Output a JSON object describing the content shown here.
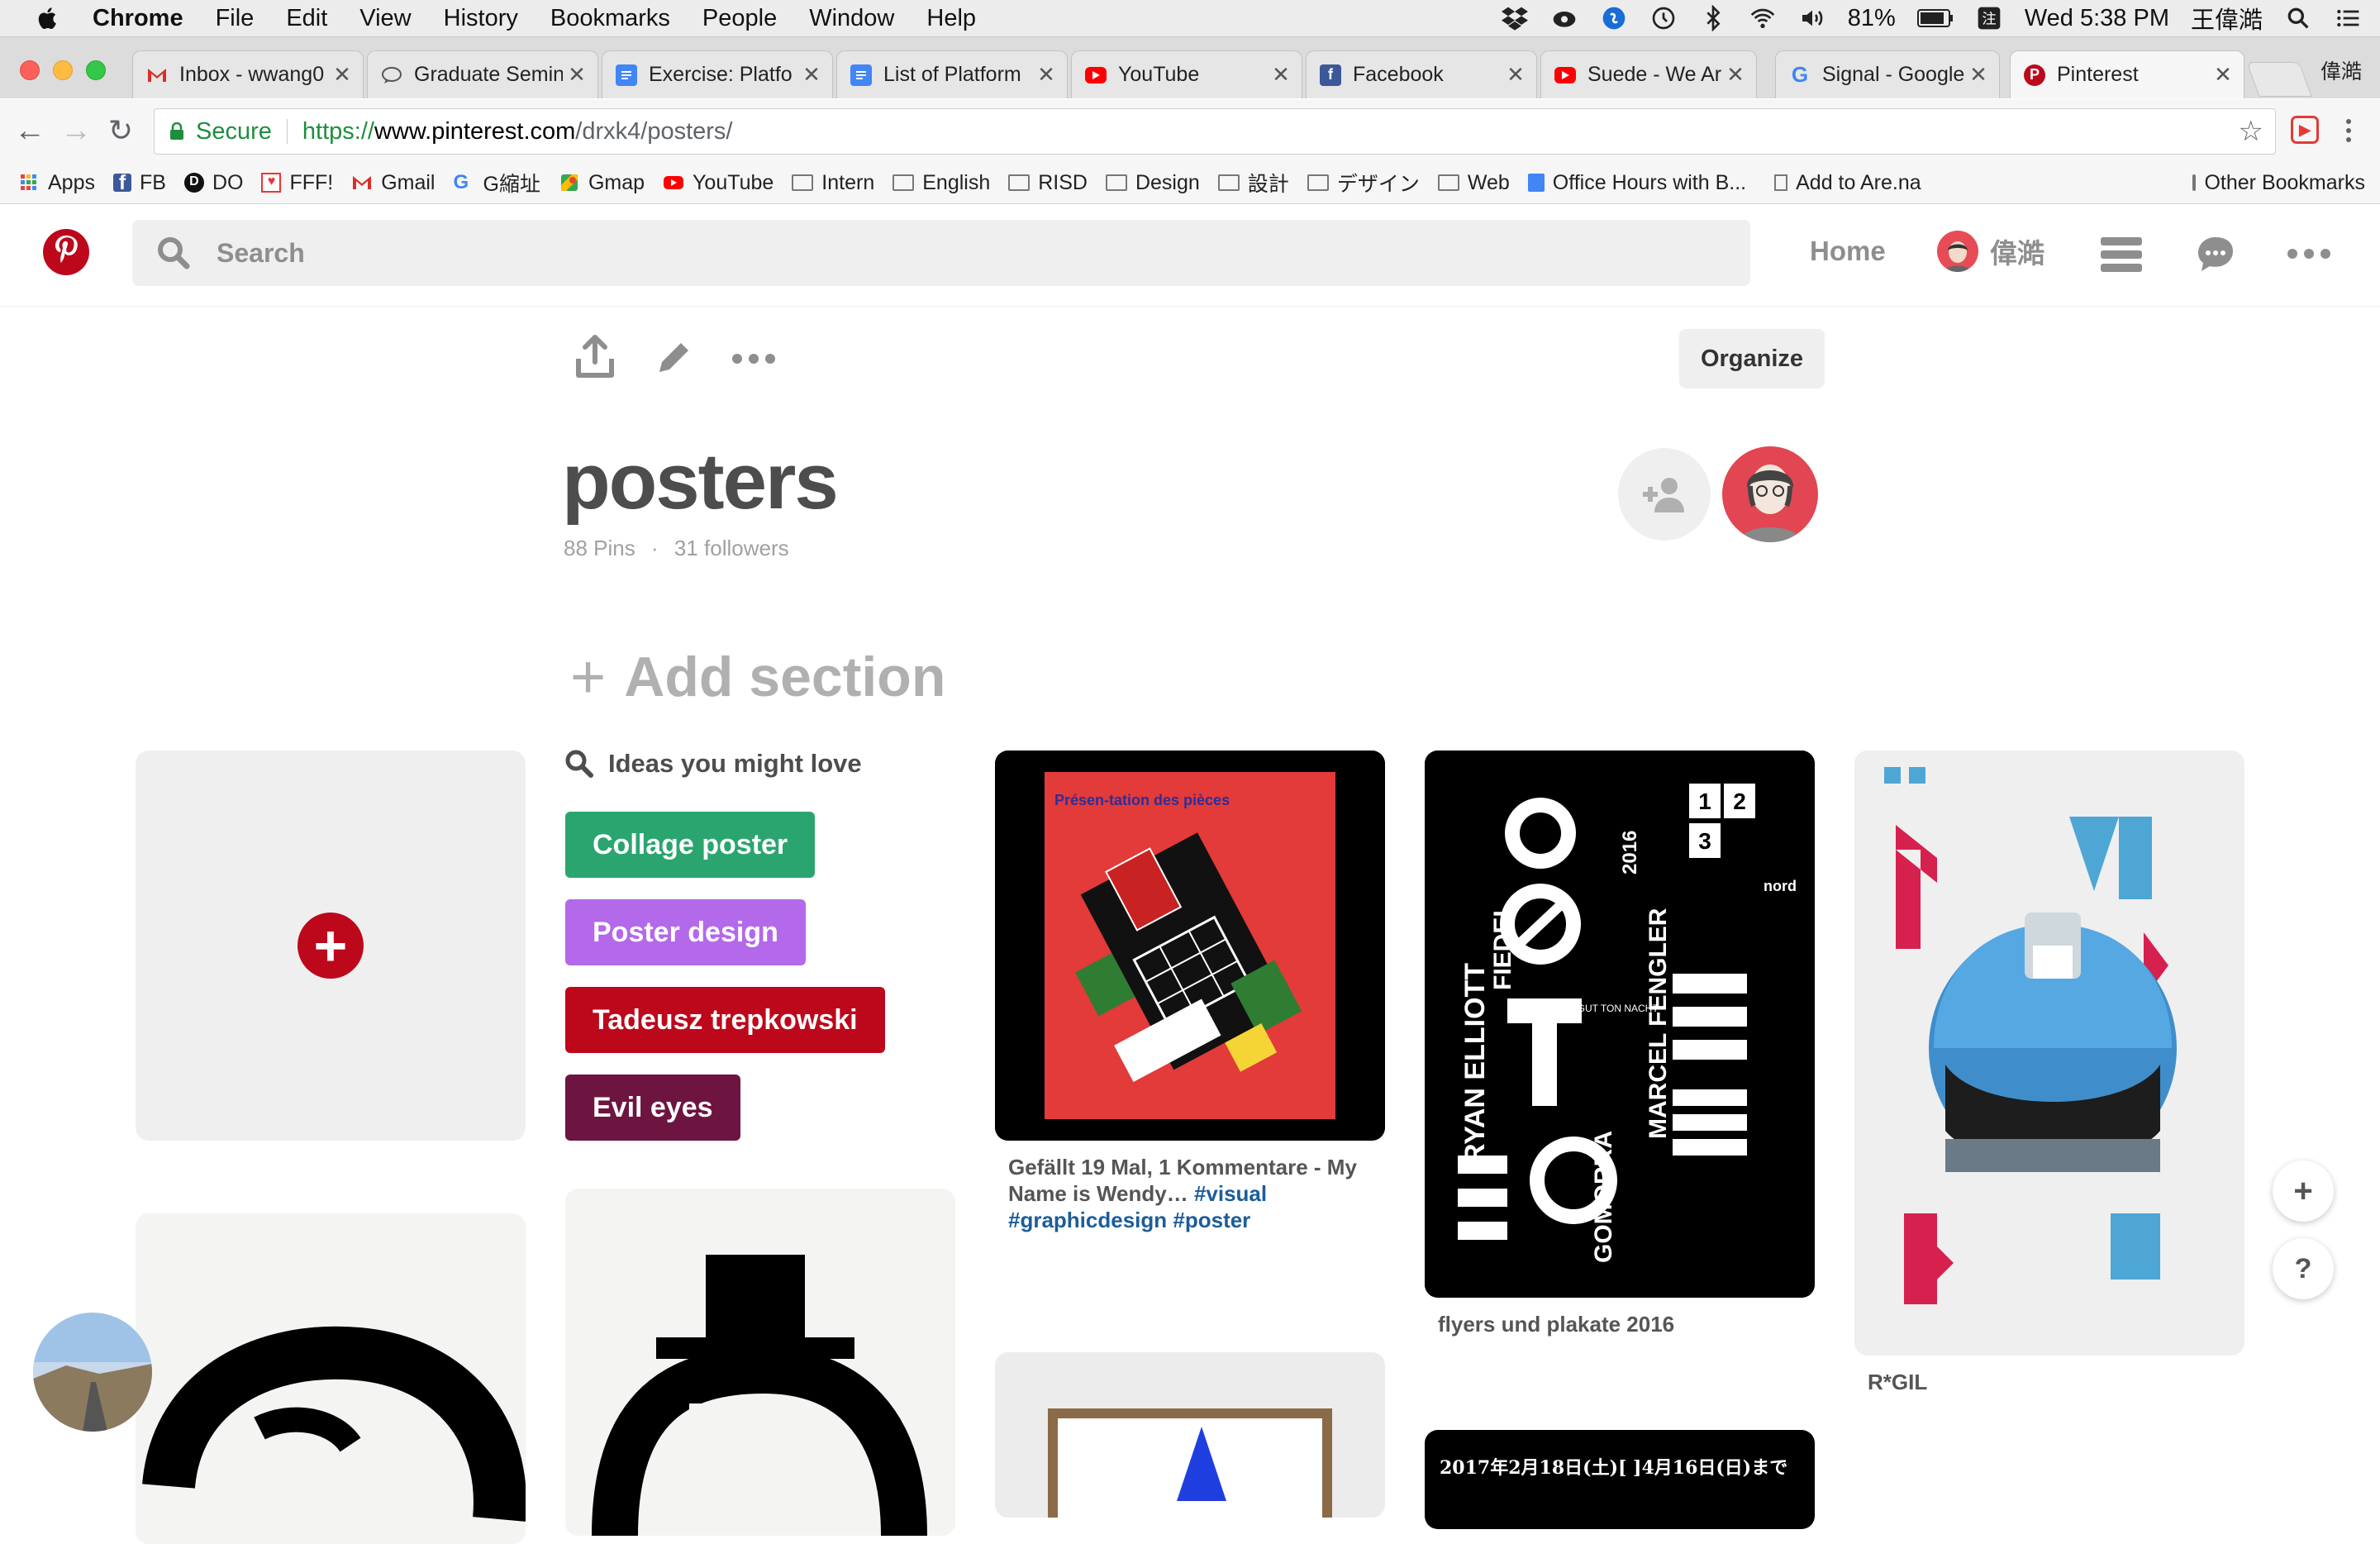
{
  "menubar": {
    "app": "Chrome",
    "items": [
      "File",
      "Edit",
      "View",
      "History",
      "Bookmarks",
      "People",
      "Window",
      "Help"
    ],
    "battery": "81%",
    "clock": "Wed 5:38 PM",
    "user": "王偉澔"
  },
  "tabs": [
    {
      "title": "Inbox - wwang0",
      "icon": "gmail-icon"
    },
    {
      "title": "Graduate Semin",
      "icon": "chat-bubble-icon"
    },
    {
      "title": "Exercise: Platfo",
      "icon": "google-docs-icon"
    },
    {
      "title": "List of Platform",
      "icon": "google-docs-icon"
    },
    {
      "title": "YouTube",
      "icon": "youtube-icon"
    },
    {
      "title": "Facebook",
      "icon": "facebook-icon"
    },
    {
      "title": "Suede - We Are",
      "icon": "youtube-icon"
    },
    {
      "title": "Signal - Google",
      "icon": "google-icon"
    },
    {
      "title": "Pinterest",
      "icon": "pinterest-icon"
    }
  ],
  "profile_name": "偉澔",
  "address": {
    "secure": "Secure",
    "scheme": "https://",
    "host": "www.pinterest.com",
    "path": "/drxk4/posters/"
  },
  "bookmarks": [
    {
      "label": "Apps",
      "icon": "apps-grid-icon"
    },
    {
      "label": "FB",
      "icon": "facebook-icon"
    },
    {
      "label": "DO",
      "icon": "digitalocean-icon"
    },
    {
      "label": "FFF!",
      "icon": "heart-icon"
    },
    {
      "label": "Gmail",
      "icon": "gmail-icon"
    },
    {
      "label": "G縮址",
      "icon": "google-icon"
    },
    {
      "label": "Gmap",
      "icon": "maps-icon"
    },
    {
      "label": "YouTube",
      "icon": "youtube-icon"
    },
    {
      "label": "Intern",
      "icon": "folder-icon"
    },
    {
      "label": "English",
      "icon": "folder-icon"
    },
    {
      "label": "RISD",
      "icon": "folder-icon"
    },
    {
      "label": "Design",
      "icon": "folder-icon"
    },
    {
      "label": "設計",
      "icon": "folder-icon"
    },
    {
      "label": "デザイン",
      "icon": "folder-icon"
    },
    {
      "label": "Web",
      "icon": "folder-icon"
    },
    {
      "label": "Office Hours with B...",
      "icon": "google-docs-icon"
    },
    {
      "label": "Add to Are.na",
      "icon": "page-icon"
    }
  ],
  "bookmarks_other": "Other Bookmarks",
  "pinterest": {
    "search_placeholder": "Search",
    "home": "Home",
    "username": "偉澔"
  },
  "board": {
    "organize": "Organize",
    "title": "posters",
    "pins": "88 Pins",
    "dot": "·",
    "followers": "31 followers",
    "add_section": "Add section"
  },
  "ideas": {
    "heading": "Ideas you might love",
    "chips": [
      {
        "label": "Collage poster",
        "color": "#2ba56f"
      },
      {
        "label": "Poster design",
        "color": "#b468ea"
      },
      {
        "label": "Tadeusz trepkowski",
        "color": "#bd081c"
      },
      {
        "label": "Evil eyes",
        "color": "#6e1441"
      }
    ]
  },
  "pins": {
    "pin1_text": "Gefällt 19 Mal, 1 Kommentare - My Name is Wendy…",
    "pin1_tags": "#visual #graphicdesign #poster",
    "pin2_text": "flyers und plakate 2016",
    "pin3_text": "R*GIL"
  },
  "poster_text": {
    "p1": "Présen-tation des pièces",
    "p2_names": "RYAN ELLIOTT",
    "p2_fiedel": "FIEDEL",
    "p2_gomorra": "GOMORRA",
    "p2_fengler": "MARCEL FENGLER",
    "p2_year": "2016",
    "p2_ostgut": "OSTGUT TON NACHT",
    "p2_nord": "nord",
    "p2_nums": [
      "1",
      "2",
      "3"
    ],
    "p4_date": "2017年2月18日(土)[ ]4月16日(日)まで"
  },
  "colors": {
    "pinterest_red": "#bd081c",
    "gray_text": "#8e8e8e"
  }
}
